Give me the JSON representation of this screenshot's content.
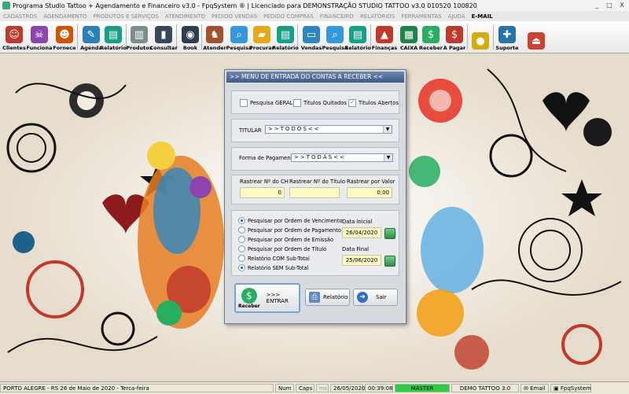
{
  "window": {
    "title": "Programa Studio Tattoo + Agendamento e Financeiro v3.0 - FpqSystem ® | Licenciado para  DEMONSTRAÇÃO STUDIO TATTOO v3.0 010520 100820",
    "controls": [
      "_",
      "□",
      "X"
    ]
  },
  "menu": [
    "CADASTROS",
    "AGENDAMENTO",
    "PRODUTOS E SERVIÇOS",
    "ATENDIMENTO",
    "PEDIDO VENDAS",
    "PEDIDO COMPRAS",
    "FINANCEIRO",
    "RELATÓRIOS",
    "FERRAMENTAS",
    "AJUDA",
    "E-MAIL"
  ],
  "toolbar": [
    {
      "label": "Clientes",
      "icon": "people-icon",
      "color": "#c0392b"
    },
    {
      "label": "Funciona",
      "icon": "skull-icon",
      "color": "#8e44ad"
    },
    {
      "label": "Fornece",
      "icon": "person-icon",
      "color": "#d35400"
    },
    {
      "label": "Agenda",
      "icon": "calendar-pen-icon",
      "color": "#2980b9"
    },
    {
      "label": "Relatório",
      "icon": "report-icon",
      "color": "#16a085"
    },
    {
      "label": "Produtos",
      "icon": "barcode-doc-icon",
      "color": "#7f8c8d"
    },
    {
      "label": "Consultar",
      "icon": "barcode-icon",
      "color": "#34495e"
    },
    {
      "label": "Book",
      "icon": "camera-icon",
      "color": "#2c3e50"
    },
    {
      "label": "Atender",
      "icon": "tattoo-artist-icon",
      "color": "#a0522d"
    },
    {
      "label": "Pesquisa",
      "icon": "search-doc-icon",
      "color": "#3498db"
    },
    {
      "label": "Procurar",
      "icon": "folder-icon",
      "color": "#e6a817"
    },
    {
      "label": "Relatório",
      "icon": "report-icon",
      "color": "#16a085"
    },
    {
      "label": "Vendas",
      "icon": "monitor-icon",
      "color": "#2e86c1"
    },
    {
      "label": "Pesquisa",
      "icon": "search-doc-icon",
      "color": "#3498db"
    },
    {
      "label": "Relatório",
      "icon": "report-icon",
      "color": "#16a085"
    },
    {
      "label": "Finanças",
      "icon": "chart-icon",
      "color": "#c0392b"
    },
    {
      "label": "CAIXA",
      "icon": "money-icon",
      "color": "#1e8449"
    },
    {
      "label": "Receber",
      "icon": "dollar-green-icon",
      "color": "#27ae60"
    },
    {
      "label": "A Pagar",
      "icon": "dollar-red-icon",
      "color": "#c0392b"
    },
    {
      "label": "",
      "icon": "coins-icon",
      "color": "#d4ac0d"
    },
    {
      "label": "Suporte",
      "icon": "support-icon",
      "color": "#2874a6"
    },
    {
      "label": "",
      "icon": "exit-icon",
      "color": "#cb4335"
    }
  ],
  "dialog": {
    "title": ">> MENU DE ENTRADA DO CONTAS A RECEBER <<",
    "checks": [
      {
        "label": "Pesquisa GERAL",
        "checked": false
      },
      {
        "label": "Titulos Quitados",
        "checked": false
      },
      {
        "label": "Titulos Abertos",
        "checked": true
      }
    ],
    "titular_label": "TITULAR",
    "titular_value": "> > T O D O S < <",
    "forma_label": "Forma de Pagamento",
    "forma_value": "> > T O D A S < <",
    "rastrear": [
      {
        "label": "Rastrear Nº do CH",
        "value": "0"
      },
      {
        "label": "Rastrear Nº do Título",
        "value": ""
      },
      {
        "label": "Rastrear por Valor",
        "value": "0,00"
      }
    ],
    "radios": [
      {
        "label": "Pesquisar por Ordem de Vencimento",
        "selected": true
      },
      {
        "label": "Pesquisar por Ordem de Pagamento",
        "selected": false
      },
      {
        "label": "Pesquisar por Ordem de Emissão",
        "selected": false
      },
      {
        "label": "Pesquisar por Ordem de Título",
        "selected": false
      },
      {
        "label": "Relatório COM Sub-Total",
        "selected": false
      },
      {
        "label": "Relatório SEM Sub-Total",
        "selected": true
      }
    ],
    "data_inicial_label": "Data Inicial",
    "data_inicial": "26/04/2020",
    "data_final_label": "Data Final",
    "data_final": "25/06/2020",
    "buttons": {
      "receber_label": "Receber",
      "entrar_label": ">>> ENTRAR",
      "relatorio_label": "Relatório",
      "sair_label": "Sair"
    }
  },
  "status": {
    "location_date": "PORTO ALEGRE - RS 26 de Maio de 2020 - Terca-feira",
    "num": "Num",
    "caps": "Caps",
    "ins": "Ins",
    "date": "26/05/2020",
    "time": "00:39:08",
    "master": "MASTER",
    "version": "DEMO TATTOO 3.0",
    "email": "Email",
    "brand": "FpqSystem"
  },
  "colors": {
    "dialog_title_bg": "#3e5a88",
    "input_yellow": "#fdf9c4",
    "master_green": "#2ecc40"
  }
}
